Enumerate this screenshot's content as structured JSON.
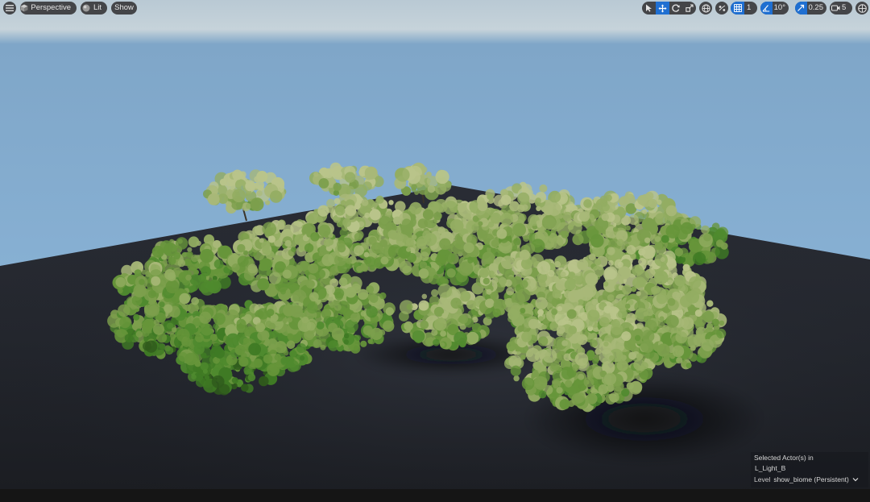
{
  "toolbar": {
    "view_mode_label": "Perspective",
    "lighting_label": "Lit",
    "show_label": "Show",
    "grid_snap_value": "1",
    "rotation_snap_value": "10°",
    "scale_snap_value": "0.25",
    "camera_speed_value": "5"
  },
  "selection_info": {
    "line1": "Selected Actor(s) in",
    "line2": "L_Light_B",
    "level_label": "Level",
    "level_value": "show_biome (Persistent)"
  },
  "colors": {
    "accent": "#1f6fd1",
    "toolbar_bg": "#3a3a3c",
    "sky_top": "#c4d2db",
    "sky_bottom": "#8bb4d6",
    "ground": "#23262d",
    "foliage_light": "#a8b878",
    "foliage_dark": "#3f7a24"
  },
  "icons": {
    "menu": "hamburger-icon",
    "perspective": "cube-icon",
    "lit": "sphere-icon",
    "select": "cursor-arrow-icon",
    "translate": "move-arrows-icon",
    "rotate": "rotate-icon",
    "scale": "scale-icon",
    "world": "globe-icon",
    "surface_snap": "surface-snap-icon",
    "grid": "grid-icon",
    "angle": "angle-icon",
    "scale_snap": "scale-arrow-icon",
    "camera": "camera-icon",
    "layout": "layout-grid-icon"
  }
}
